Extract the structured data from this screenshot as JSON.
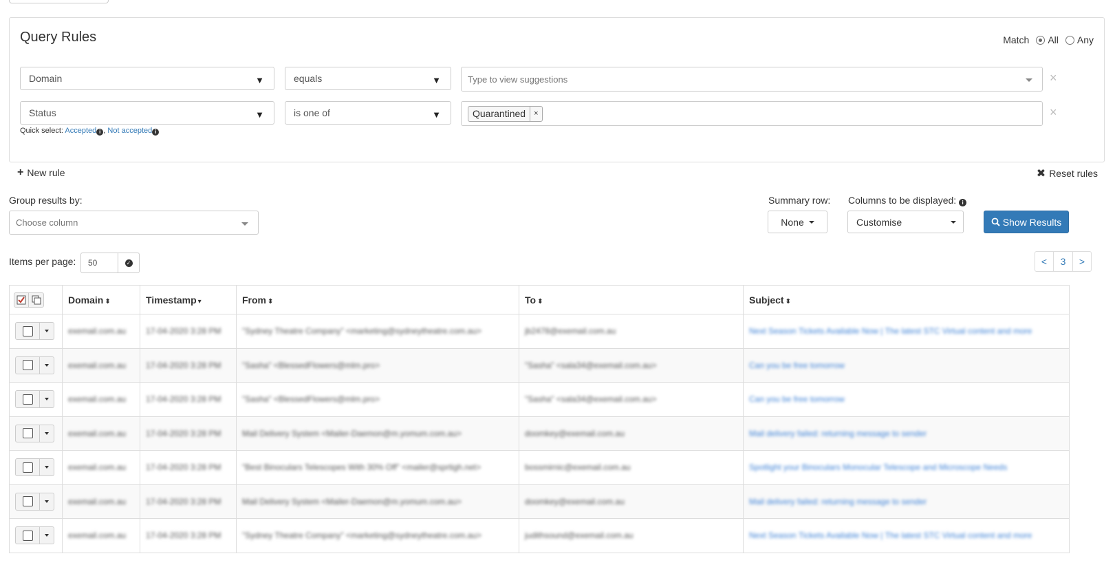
{
  "query_rules": {
    "title": "Query Rules",
    "match_label": "Match",
    "match_options": [
      "All",
      "Any"
    ],
    "match_selected": "All",
    "rules": [
      {
        "field": "Domain",
        "operator": "equals",
        "value_placeholder": "Type to view suggestions"
      },
      {
        "field": "Status",
        "operator": "is one of",
        "tags": [
          "Quarantined"
        ]
      }
    ],
    "quick_select_label": "Quick select:",
    "quick_select_options": [
      "Accepted",
      "Not accepted"
    ]
  },
  "actions": {
    "new_rule": "New rule",
    "reset_rules": "Reset rules"
  },
  "group_by": {
    "label": "Group results by:",
    "placeholder": "Choose column"
  },
  "summary_row": {
    "label": "Summary row:",
    "value": "None"
  },
  "columns_display": {
    "label": "Columns to be displayed:",
    "value": "Customise"
  },
  "show_results": "Show Results",
  "items_per_page": {
    "label": "Items per page:",
    "value": "50"
  },
  "pagination": {
    "prev": "<",
    "current": "3",
    "next": ">"
  },
  "table": {
    "columns": [
      "Domain",
      "Timestamp",
      "From",
      "To",
      "Subject"
    ],
    "rows": [
      {
        "domain": "exemail.com.au",
        "timestamp": "17-04-2020 3:28 PM",
        "from": "\"Sydney Theatre Company\" <marketing@sydneytheatre.com.au>",
        "to": "jb2478@exemail.com.au",
        "subject": "Next Season Tickets Available Now | The latest STC Virtual content and more"
      },
      {
        "domain": "exemail.com.au",
        "timestamp": "17-04-2020 3:28 PM",
        "from": "\"Sasha\" <BlessedFlowers@mlm.pro>",
        "to": "\"Sasha\" <sala34@exemail.com.au>",
        "subject": "Can you be free tomorrow"
      },
      {
        "domain": "exemail.com.au",
        "timestamp": "17-04-2020 3:28 PM",
        "from": "\"Sasha\" <BlessedFlowers@mlm.pro>",
        "to": "\"Sasha\" <sala34@exemail.com.au>",
        "subject": "Can you be free tomorrow"
      },
      {
        "domain": "exemail.com.au",
        "timestamp": "17-04-2020 3:28 PM",
        "from": "Mail Delivery System <Mailer-Daemon@m.yomum.com.au>",
        "to": "doomkey@exemail.com.au",
        "subject": "Mail delivery failed: returning message to sender"
      },
      {
        "domain": "exemail.com.au",
        "timestamp": "17-04-2020 3:28 PM",
        "from": "\"Best Binoculars Telescopes With 30% Off\" <mailer@sprtigh.net>",
        "to": "bossmirnic@exemail.com.au",
        "subject": "Spotlight your Binoculars Monocular Telescope and Microscope Needs"
      },
      {
        "domain": "exemail.com.au",
        "timestamp": "17-04-2020 3:28 PM",
        "from": "Mail Delivery System <Mailer-Daemon@m.yomum.com.au>",
        "to": "doomkey@exemail.com.au",
        "subject": "Mail delivery failed: returning message to sender"
      },
      {
        "domain": "exemail.com.au",
        "timestamp": "17-04-2020 3:28 PM",
        "from": "\"Sydney Theatre Company\" <marketing@sydneytheatre.com.au>",
        "to": "judithsound@exemail.com.au",
        "subject": "Next Season Tickets Available Now | The latest STC Virtual content and more"
      }
    ]
  }
}
